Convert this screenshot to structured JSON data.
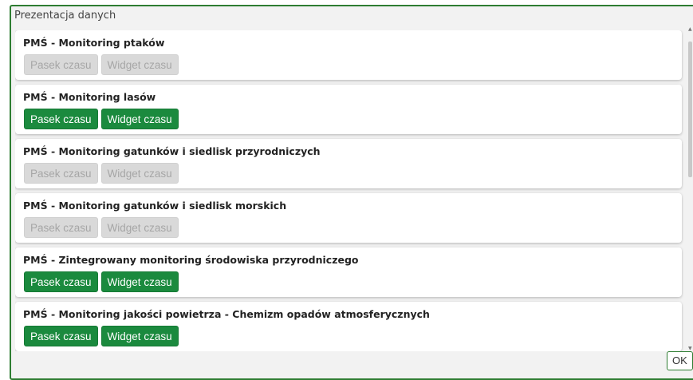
{
  "dialog": {
    "title": "Prezentacja danych",
    "ok_label": "OK"
  },
  "items": [
    {
      "title": "PMŚ - Monitoring ptaków",
      "timeline_label": "Pasek czasu",
      "widget_label": "Widget czasu",
      "enabled": false
    },
    {
      "title": "PMŚ - Monitoring lasów",
      "timeline_label": "Pasek czasu",
      "widget_label": "Widget czasu",
      "enabled": true
    },
    {
      "title": "PMŚ - Monitoring gatunków i siedlisk przyrodniczych",
      "timeline_label": "Pasek czasu",
      "widget_label": "Widget czasu",
      "enabled": false
    },
    {
      "title": "PMŚ - Monitoring gatunków i siedlisk morskich",
      "timeline_label": "Pasek czasu",
      "widget_label": "Widget czasu",
      "enabled": false
    },
    {
      "title": "PMŚ - Zintegrowany monitoring środowiska przyrodniczego",
      "timeline_label": "Pasek czasu",
      "widget_label": "Widget czasu",
      "enabled": true
    },
    {
      "title": "PMŚ - Monitoring jakości powietrza - Chemizm opadów atmosferycznych",
      "timeline_label": "Pasek czasu",
      "widget_label": "Widget czasu",
      "enabled": true
    }
  ],
  "colors": {
    "accent": "#1b8a3e",
    "disabled": "#d9d9d9",
    "border": "#2e7d32"
  }
}
